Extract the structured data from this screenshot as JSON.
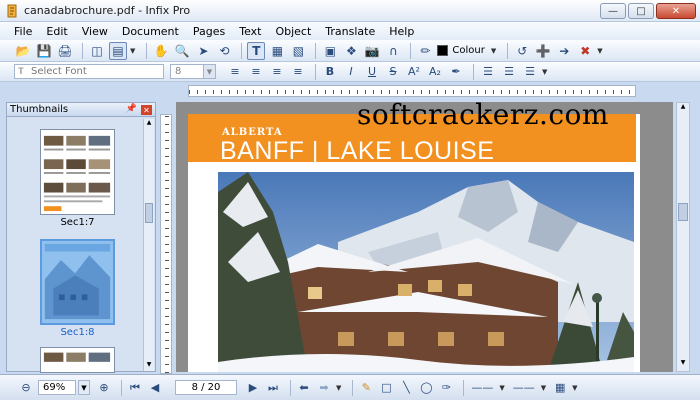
{
  "window": {
    "title": "canadabrochure.pdf - Infix Pro"
  },
  "menu": [
    "File",
    "Edit",
    "View",
    "Document",
    "Pages",
    "Text",
    "Object",
    "Translate",
    "Help"
  ],
  "toolbar": {
    "colour_label": "Colour"
  },
  "format_bar": {
    "font_placeholder": "Select Font",
    "font_size": "8"
  },
  "thumbnails": {
    "title": "Thumbnails",
    "items": [
      "Sec1:7",
      "Sec1:8"
    ]
  },
  "document": {
    "banner_small": "ALBERTA",
    "banner_big": "BANFF | LAKE LOUISE"
  },
  "watermark": "softcrackerz.com",
  "status": {
    "zoom": "69%",
    "page": "8 / 20"
  },
  "colors": {
    "banner": "#f29020",
    "accent": "#2a4c7c"
  }
}
